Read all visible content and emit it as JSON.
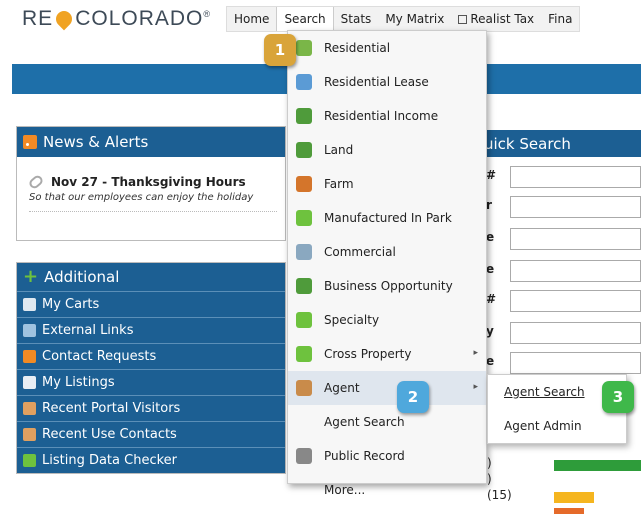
{
  "logo": {
    "left": "RE",
    "right": "COLORADO",
    "mark": "®"
  },
  "nav": [
    {
      "label": "Home"
    },
    {
      "label": "Search",
      "active": true
    },
    {
      "label": "Stats"
    },
    {
      "label": "My Matrix"
    },
    {
      "label": "Realist Tax",
      "icon": "window-icon"
    },
    {
      "label": "Fina"
    }
  ],
  "news": {
    "title": "News & Alerts",
    "item_title": "Nov 27 - Thanksgiving Hours",
    "item_body": "So that our employees can enjoy the holiday"
  },
  "additional": {
    "title": "Additional",
    "links": [
      {
        "label": "My Carts",
        "icon": "cart-icon",
        "color": "#dfe8f0"
      },
      {
        "label": "External Links",
        "icon": "chain-icon",
        "color": "#9fc3e0"
      },
      {
        "label": "Contact Requests",
        "icon": "contact-icon",
        "color": "#f08a24"
      },
      {
        "label": "My Listings",
        "icon": "listing-icon",
        "color": "#e8eef4"
      },
      {
        "label": "Recent Portal Visitors",
        "icon": "person-icon",
        "color": "#e0a060"
      },
      {
        "label": "Recent Use Contacts",
        "icon": "people-icon",
        "color": "#e0a060"
      },
      {
        "label": "Listing Data Checker",
        "icon": "checker-icon",
        "color": "#6ec23e"
      }
    ]
  },
  "quick_search": {
    "title": "uick Search",
    "labels": [
      "#",
      "r",
      "e",
      "e",
      "#",
      "y",
      "e"
    ]
  },
  "status_bits": {
    "line1": ")",
    "line2": ")",
    "line3": "(15)"
  },
  "search_menu": [
    {
      "label": "Residential",
      "icon": "house-icon",
      "color": "#7ab648"
    },
    {
      "label": "Residential Lease",
      "icon": "lease-icon",
      "color": "#5b9bd5"
    },
    {
      "label": "Residential Income",
      "icon": "income-icon",
      "color": "#4f9b3b"
    },
    {
      "label": "Land",
      "icon": "tree-icon",
      "color": "#4f9b3b"
    },
    {
      "label": "Farm",
      "icon": "tractor-icon",
      "color": "#d4752b"
    },
    {
      "label": "Manufactured In Park",
      "icon": "expand-icon",
      "color": "#6ec23e"
    },
    {
      "label": "Commercial",
      "icon": "building-icon",
      "color": "#8aa8c0"
    },
    {
      "label": "Business Opportunity",
      "icon": "business-icon",
      "color": "#4f9b3b"
    },
    {
      "label": "Specialty",
      "icon": "expand-icon",
      "color": "#6ec23e"
    },
    {
      "label": "Cross Property",
      "icon": "expand-icon",
      "color": "#6ec23e",
      "arrow": "▸"
    },
    {
      "label": "Agent",
      "icon": "agent-icon",
      "color": "#c98b4a",
      "arrow": "▸",
      "highlight": true
    },
    {
      "label": "Agent Search",
      "icon": "",
      "color": ""
    },
    {
      "label": "Public Record",
      "icon": "bank-icon",
      "color": "#888888"
    },
    {
      "label": "More...",
      "icon": "",
      "color": ""
    }
  ],
  "agent_submenu": [
    {
      "label": "Agent Search",
      "underline": true
    },
    {
      "label": "Agent Admin"
    }
  ],
  "callouts": [
    {
      "n": "1",
      "color": "#d9a43a"
    },
    {
      "n": "2",
      "color": "#4fa8dc"
    },
    {
      "n": "3",
      "color": "#3fb84a"
    }
  ]
}
